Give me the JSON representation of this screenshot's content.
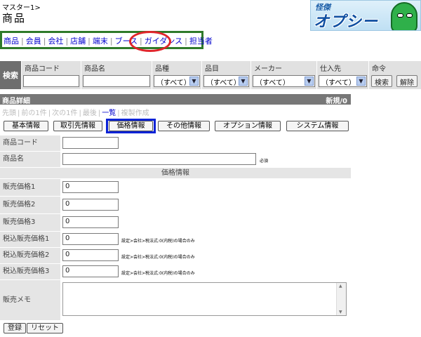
{
  "header": {
    "breadcrumb": "マスター1>",
    "title": "商品",
    "logo_top": "怪傑",
    "logo_main": "オプシー"
  },
  "top_nav": {
    "items": [
      "商品",
      "会員",
      "会社",
      "店舗",
      "端末",
      "ブース",
      "ガイダンス",
      "担当者"
    ]
  },
  "search": {
    "label": "検索",
    "columns": {
      "product_code": "商品コード",
      "product_name": "商品名",
      "kind": "品種",
      "item": "品目",
      "maker": "メーカー",
      "supplier": "仕入先",
      "command": "命令"
    },
    "kind_value": "（すべて）",
    "item_value": "（すべて）",
    "maker_value": "（すべて）",
    "supplier_value": "（すべて）",
    "search_button": "検索",
    "clear_button": "解除"
  },
  "detail": {
    "header_title": "商品詳細",
    "header_status": "新規/0",
    "record_nav": {
      "first": "先頭",
      "prev": "前の1件",
      "next": "次の1件",
      "last": "最後",
      "list": "一覧",
      "duplicate": "複製作成"
    },
    "tabs": [
      "基本情報",
      "取引先情報",
      "価格情報",
      "その他情報",
      "オプション情報",
      "システム情報"
    ],
    "fields": {
      "product_code_label": "商品コード",
      "product_name_label": "商品名",
      "required_note": "必須",
      "price_section_title": "価格情報",
      "sale_price1_label": "販売価格1",
      "sale_price1_value": "0",
      "sale_price2_label": "販売価格2",
      "sale_price2_value": "0",
      "sale_price3_label": "販売価格3",
      "sale_price3_value": "0",
      "tax_price1_label": "税込販売価格1",
      "tax_price1_value": "0",
      "tax_price2_label": "税込販売価格2",
      "tax_price2_value": "0",
      "tax_price3_label": "税込販売価格3",
      "tax_price3_value": "0",
      "tax_note": "設定>会社>税法式:0(内税)の場合のみ",
      "memo_label": "販売メモ"
    }
  },
  "actions": {
    "register": "登録",
    "reset": "リセット"
  },
  "colors": {
    "nav_border": "#2f7a2a",
    "highlight_circle": "#e0252b",
    "highlight_tab": "#0b23d6",
    "link": "#0000cc"
  }
}
